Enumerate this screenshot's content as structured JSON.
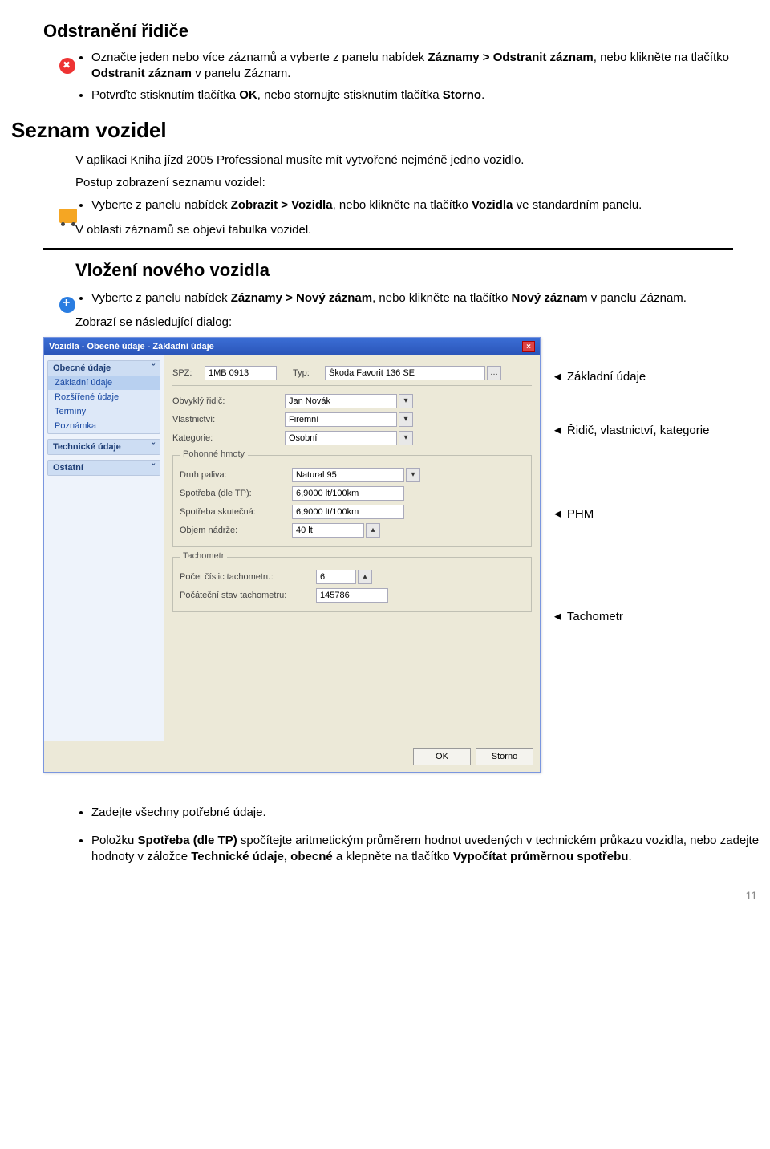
{
  "headings": {
    "h_del_driver": "Odstranění řidiče",
    "h_vehicles": "Seznam vozidel",
    "h_new_vehicle": "Vložení nového vozidla"
  },
  "sec_del": {
    "b1_pre": "Označte jeden nebo více záznamů a vyberte z panelu nabídek ",
    "b1_bold": "Záznamy > Odstranit záznam",
    "b1_mid": ", nebo klikněte na tlačítko ",
    "b1_bold2": "Odstranit záznam",
    "b1_post": " v panelu Záznam.",
    "b2_pre": "Potvrďte stisknutím tlačítka ",
    "b2_bold": "OK",
    "b2_mid": ", nebo stornujte stisknutím tlačítka ",
    "b2_bold2": "Storno",
    "b2_post": "."
  },
  "sec_list": {
    "p1": "V aplikaci Kniha jízd 2005 Professional musíte mít vytvořené nejméně jedno vozidlo.",
    "p2": "Postup zobrazení seznamu vozidel:",
    "b1_pre": "Vyberte z panelu nabídek ",
    "b1_bold": "Zobrazit > Vozidla",
    "b1_mid": ", nebo klikněte na tlačítko ",
    "b1_bold2": "Vozidla",
    "b1_post": " ve standardním panelu.",
    "p3": "V oblasti záznamů se objeví tabulka vozidel."
  },
  "sec_new": {
    "b1_pre": "Vyberte z panelu nabídek ",
    "b1_bold": "Záznamy > Nový záznam",
    "b1_mid": ", nebo klikněte na tlačítko ",
    "b1_bold2": "Nový záznam",
    "b1_post": " v panelu Záznam.",
    "p1": "Zobrazí se následující dialog:"
  },
  "dialog": {
    "title": "Vozidla - Obecné údaje - Základní údaje",
    "side": {
      "g1_head": "Obecné údaje",
      "g1_items": [
        "Základní údaje",
        "Rozšířené údaje",
        "Termíny",
        "Poznámka"
      ],
      "g2_head": "Technické údaje",
      "g3_head": "Ostatní",
      "chev": "ˇ"
    },
    "fields": {
      "spz_l": "SPZ:",
      "spz_v": "1MB 0913",
      "typ_l": "Typ:",
      "typ_v": "Škoda Favorit 136 SE",
      "ridic_l": "Obvyklý řidič:",
      "ridic_v": "Jan Novák",
      "vlast_l": "Vlastnictví:",
      "vlast_v": "Firemní",
      "kat_l": "Kategorie:",
      "kat_v": "Osobní",
      "phm_head": "Pohonné hmoty",
      "palivo_l": "Druh paliva:",
      "palivo_v": "Natural 95",
      "sptp_l": "Spotřeba (dle TP):",
      "sptp_v": "6,9000 lt/100km",
      "spsk_l": "Spotřeba skutečná:",
      "spsk_v": "6,9000 lt/100km",
      "nadrz_l": "Objem nádrže:",
      "nadrz_v": "40 lt",
      "tach_head": "Tachometr",
      "cidl_l": "Počet číslic tachometru:",
      "cidl_v": "6",
      "poc_l": "Počáteční stav tachometru:",
      "poc_v": "145786"
    },
    "buttons": {
      "ok": "OK",
      "storno": "Storno"
    }
  },
  "callouts": {
    "c1": "Základní údaje",
    "c2": "Řidič, vlastnictví, kategorie",
    "c3": "PHM",
    "c4": "Tachometr",
    "tri": "◄"
  },
  "sec_end": {
    "b1": "Zadejte všechny potřebné údaje.",
    "b2_pre": "Položku ",
    "b2_b1": "Spotřeba (dle TP)",
    "b2_mid1": " spočítejte aritmetickým průměrem hodnot uvedených v technickém průkazu vozidla, nebo zadejte hodnoty v záložce ",
    "b2_b2": "Technické údaje, obecné",
    "b2_mid2": " a klepněte na tlačítko ",
    "b2_b3": "Vypočítat průměrnou spotřebu",
    "b2_post": "."
  },
  "page_num": "11"
}
